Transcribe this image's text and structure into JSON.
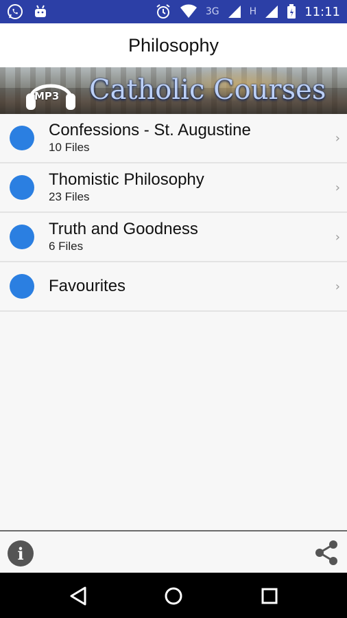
{
  "status_bar": {
    "network_labels": [
      "3G",
      "H"
    ],
    "time": "11:11",
    "icons": [
      "whatsapp-icon",
      "android-icon",
      "alarm-icon",
      "wifi-icon",
      "signal-icon",
      "battery-icon"
    ]
  },
  "header": {
    "title": "Philosophy"
  },
  "banner": {
    "badge": "MP3",
    "title": "Catholic Courses"
  },
  "list": [
    {
      "title": "Confessions - St. Augustine",
      "subtitle": "10 Files"
    },
    {
      "title": "Thomistic Philosophy",
      "subtitle": "23 Files"
    },
    {
      "title": "Truth and Goodness",
      "subtitle": "6 Files"
    },
    {
      "title": "Favourites",
      "subtitle": ""
    }
  ],
  "toolbar": {
    "info_label": "i"
  },
  "colors": {
    "status_bar": "#2c3fa6",
    "accent_dot": "#2b7fe1",
    "background": "#f7f7f7"
  }
}
